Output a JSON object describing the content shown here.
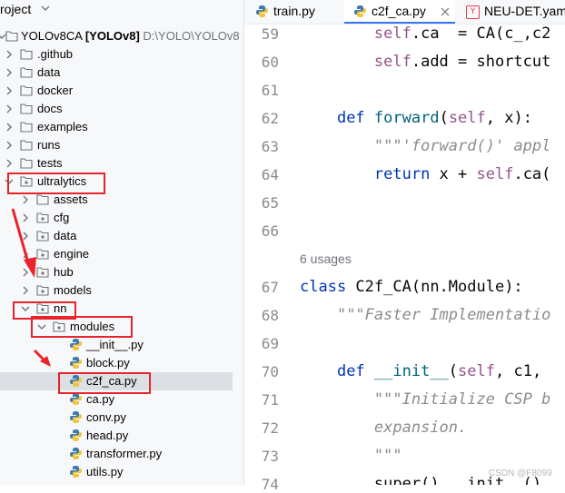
{
  "project_panel": {
    "title": "roject",
    "root": {
      "name": "YOLOv8CA",
      "module": "[YOLOv8]",
      "path": "D:\\YOLO\\YOLOv8"
    },
    "tree": [
      {
        "label": ".github",
        "kind": "folder"
      },
      {
        "label": "data",
        "kind": "folder"
      },
      {
        "label": "docker",
        "kind": "folder"
      },
      {
        "label": "docs",
        "kind": "folder"
      },
      {
        "label": "examples",
        "kind": "folder"
      },
      {
        "label": "runs",
        "kind": "folder"
      },
      {
        "label": "tests",
        "kind": "folder"
      },
      {
        "label": "ultralytics",
        "kind": "package"
      },
      {
        "label": "assets",
        "kind": "folder"
      },
      {
        "label": "cfg",
        "kind": "package"
      },
      {
        "label": "data",
        "kind": "package"
      },
      {
        "label": "engine",
        "kind": "package"
      },
      {
        "label": "hub",
        "kind": "package"
      },
      {
        "label": "models",
        "kind": "package"
      },
      {
        "label": "nn",
        "kind": "package"
      },
      {
        "label": "modules",
        "kind": "package"
      },
      {
        "label": "__init__.py",
        "kind": "python"
      },
      {
        "label": "block.py",
        "kind": "python"
      },
      {
        "label": "c2f_ca.py",
        "kind": "python"
      },
      {
        "label": "ca.py",
        "kind": "python"
      },
      {
        "label": "conv.py",
        "kind": "python"
      },
      {
        "label": "head.py",
        "kind": "python"
      },
      {
        "label": "transformer.py",
        "kind": "python"
      },
      {
        "label": "utils.py",
        "kind": "python"
      }
    ],
    "selected": "c2f_ca.py",
    "annotation_color": "#e8232a"
  },
  "tabs": [
    {
      "label": "train.py",
      "icon": "python-icon"
    },
    {
      "label": "c2f_ca.py",
      "icon": "python-icon",
      "active": true
    },
    {
      "label": "NEU-DET.yaml",
      "icon": "yaml-icon"
    }
  ],
  "editor": {
    "line_numbers": [
      "59",
      "60",
      "61",
      "62",
      "63",
      "64",
      "65",
      "66",
      "67",
      "68",
      "69",
      "70",
      "71",
      "72",
      "73",
      "74"
    ],
    "usages_hint": "6 usages",
    "lines": [
      {
        "indent": "        ",
        "parts": [
          [
            "self",
            "self"
          ],
          [
            ".ca  = CA(c_,c2",
            "plain"
          ]
        ]
      },
      {
        "indent": "        ",
        "parts": [
          [
            "self",
            "self"
          ],
          [
            ".add = shortcut",
            "plain"
          ]
        ]
      },
      {
        "indent": "",
        "parts": []
      },
      {
        "indent": "    ",
        "parts": [
          [
            "def ",
            "kw"
          ],
          [
            "forward",
            "fn"
          ],
          [
            "(",
            "plain"
          ],
          [
            "self",
            "self"
          ],
          [
            ", x):",
            "plain"
          ]
        ]
      },
      {
        "indent": "        ",
        "parts": [
          [
            "\"\"\"'forward()' appl",
            "doc"
          ]
        ]
      },
      {
        "indent": "        ",
        "parts": [
          [
            "return ",
            "kw"
          ],
          [
            "x + ",
            "plain"
          ],
          [
            "self",
            "self"
          ],
          [
            ".ca(",
            "plain"
          ]
        ]
      },
      {
        "indent": "",
        "parts": []
      },
      {
        "indent": "",
        "parts": []
      },
      {
        "indent": "",
        "parts": [
          [
            "class ",
            "kw"
          ],
          [
            "C2f_CA",
            "plain"
          ],
          [
            "(nn.Module):",
            "plain"
          ]
        ]
      },
      {
        "indent": "    ",
        "parts": [
          [
            "\"\"\"Faster Implementatio",
            "doc"
          ]
        ]
      },
      {
        "indent": "",
        "parts": []
      },
      {
        "indent": "    ",
        "parts": [
          [
            "def ",
            "kw"
          ],
          [
            "__init__",
            "fn"
          ],
          [
            "(",
            "plain"
          ],
          [
            "self",
            "self"
          ],
          [
            ", c1,",
            "plain"
          ]
        ]
      },
      {
        "indent": "        ",
        "parts": [
          [
            "\"\"\"Initialize CSP b",
            "doc"
          ]
        ]
      },
      {
        "indent": "        ",
        "parts": [
          [
            "expansion.",
            "doc"
          ]
        ]
      },
      {
        "indent": "        ",
        "parts": [
          [
            "\"\"\"",
            "doc"
          ]
        ]
      },
      {
        "indent": "        ",
        "parts": [
          [
            "super",
            "plain"
          ],
          [
            "().__init__()",
            "plain"
          ]
        ]
      }
    ]
  },
  "watermark": "CSDN @F8099"
}
